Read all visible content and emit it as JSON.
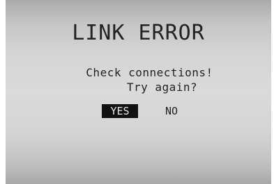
{
  "dialog": {
    "title": "LINK ERROR",
    "message_line1": "Check connections!",
    "message_line2": "Try again?",
    "yes_label": "YES",
    "no_label": "NO",
    "selected_option": "YES"
  },
  "colors": {
    "screen_bg": "#d4d4d4",
    "text": "#222222",
    "selected_bg": "#111111",
    "selected_text": "#e6e6e6"
  }
}
